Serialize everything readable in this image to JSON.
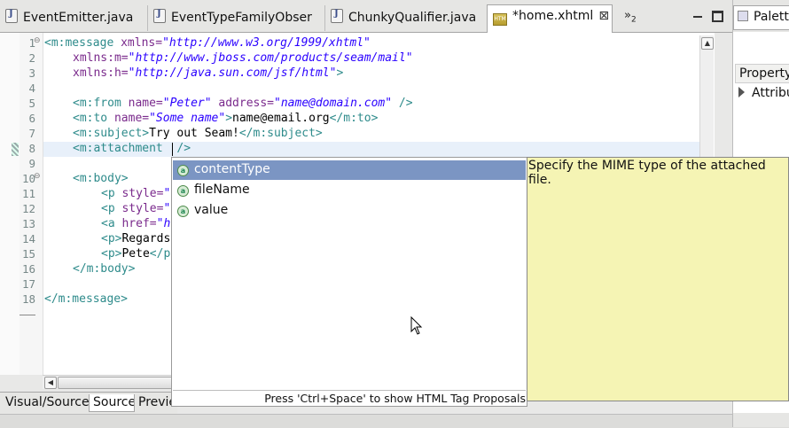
{
  "tabs": [
    {
      "label": "EventEmitter.java",
      "icon": "java-file-icon"
    },
    {
      "label": "EventTypeFamilyObser",
      "icon": "java-file-icon"
    },
    {
      "label": "ChunkyQualifier.java",
      "icon": "java-file-icon"
    },
    {
      "label": "*home.xhtml",
      "icon": "xhtml-file-icon",
      "active": true
    }
  ],
  "overflow_count": "2",
  "right_tab": {
    "label": "Palette"
  },
  "property_panel": {
    "header": "Property",
    "row": "Attribu"
  },
  "editor": {
    "line_numbers": [
      "1",
      "2",
      "3",
      "4",
      "5",
      "6",
      "7",
      "8",
      "9",
      "10",
      "11",
      "12",
      "13",
      "14",
      "15",
      "16",
      "17",
      "18"
    ],
    "lines": {
      "l1": {
        "tag": "<m:message",
        "attr": "xmlns=",
        "val": "\"http://www.w3.org/1999/xhtml\""
      },
      "l2": {
        "attr": "xmlns:m=",
        "val": "\"http://www.jboss.com/products/seam/mail\""
      },
      "l3": {
        "attr": "xmlns:h=",
        "val": "\"http://java.sun.com/jsf/html\"",
        "end": ">"
      },
      "l5": {
        "tag": "<m:from",
        "attr1": "name=",
        "val1": "\"Peter\"",
        "attr2": "address=",
        "val2": "\"name@domain.com\"",
        "end": "/>"
      },
      "l6": {
        "tag": "<m:to",
        "attr": "name=",
        "val": "\"Some name\"",
        "open_end": ">",
        "text": "name@email.org",
        "close": "</m:to>"
      },
      "l7": {
        "tag": "<m:subject>",
        "text": "Try out Seam!",
        "close": "</m:subject>"
      },
      "l8": {
        "tag": "<m:attachment",
        "end": "/>"
      },
      "l10": {
        "tag": "<m:body>"
      },
      "l11": {
        "tag": "<p",
        "attr": "style=",
        "val": "\""
      },
      "l12": {
        "tag": "<p",
        "attr": "style=",
        "val": "\""
      },
      "l13": {
        "tag": "<a",
        "attr": "href=",
        "val": "\"h"
      },
      "l14": {
        "tag": "<p>",
        "text": "Regards"
      },
      "l15": {
        "tag": "<p>",
        "text": "Pete",
        "close": "</p"
      },
      "l16": {
        "tag": "</m:body>"
      },
      "l18": {
        "tag": "</m:message>"
      }
    }
  },
  "content_assist": {
    "items": [
      {
        "label": "contentType",
        "selected": true
      },
      {
        "label": "fileName"
      },
      {
        "label": "value"
      }
    ],
    "footer": "Press 'Ctrl+Space' to show HTML Tag Proposals"
  },
  "doc_popup": {
    "text": "Specify the MIME type of the attached file."
  },
  "page_tabs": [
    {
      "label": "Visual/Source"
    },
    {
      "label": "Source",
      "active": true
    },
    {
      "label": "Previe"
    }
  ],
  "colors": {
    "tag": "#2e8b8b",
    "attribute": "#7a2a8c",
    "value": "#2a00ff",
    "selection": "#7b95c3",
    "doc_bg": "#f5f4b4"
  }
}
